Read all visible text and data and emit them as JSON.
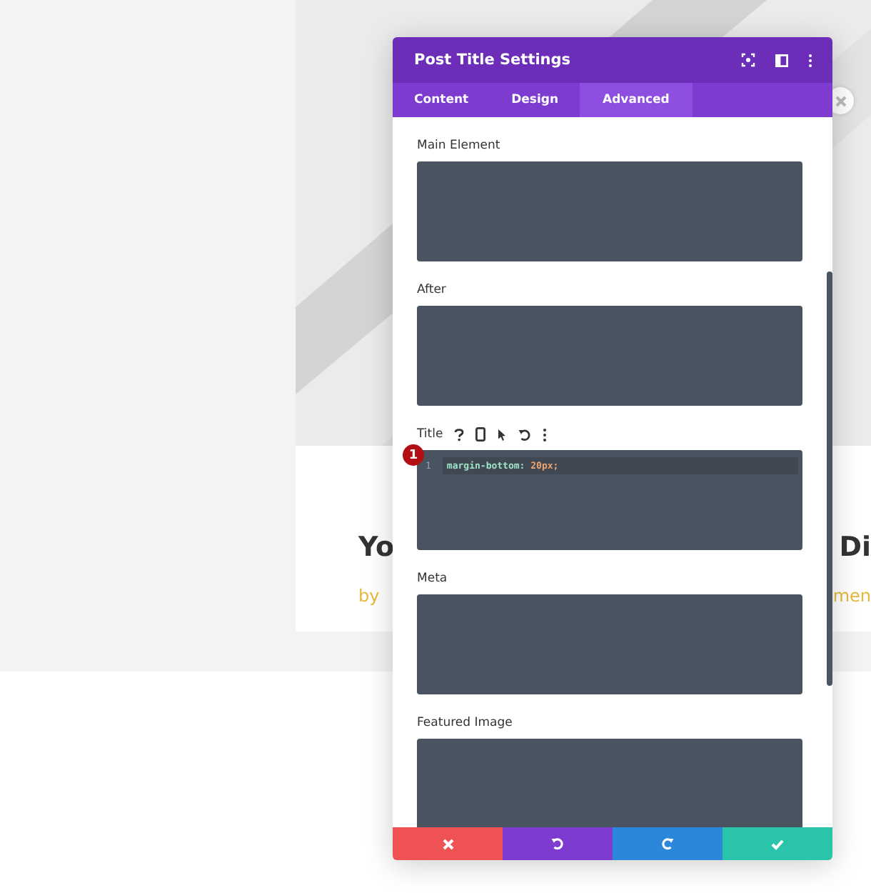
{
  "page": {
    "post_title_left": "Yo",
    "post_title_right": "Di",
    "meta_left": "by",
    "meta_right": "men"
  },
  "panel": {
    "title": "Post Title Settings",
    "tabs": [
      {
        "label": "Content",
        "selected": false
      },
      {
        "label": "Design",
        "selected": false
      },
      {
        "label": "Advanced",
        "selected": true
      }
    ],
    "fields": [
      {
        "label": "Main Element",
        "kind": "plain"
      },
      {
        "label": "After",
        "kind": "plain"
      },
      {
        "label": "Title",
        "kind": "tools",
        "badge": "1",
        "code_lines": [
          {
            "number": "1",
            "property": "margin-bottom:",
            "value": "20px;"
          }
        ]
      },
      {
        "label": "Meta",
        "kind": "plain"
      },
      {
        "label": "Featured Image",
        "kind": "plain"
      }
    ],
    "footer": [
      {
        "kind": "cancel"
      },
      {
        "kind": "undo"
      },
      {
        "kind": "redo"
      },
      {
        "kind": "save"
      }
    ]
  }
}
